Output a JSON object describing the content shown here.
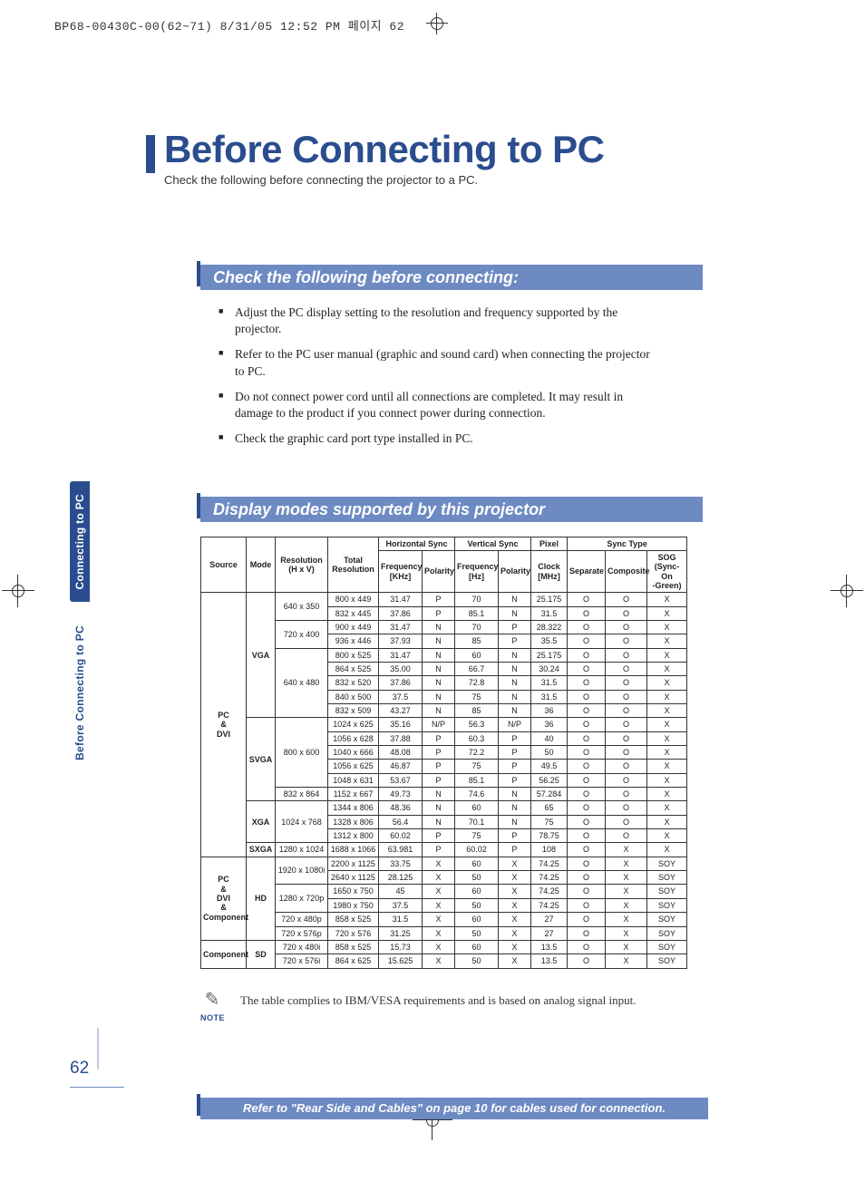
{
  "crop_header": "BP68-00430C-00(62~71)  8/31/05  12:52 PM  페이지 62",
  "side_tabs": {
    "top": "Connecting to PC",
    "bottom": "Before Connecting to PC"
  },
  "title": "Before Connecting to PC",
  "subtitle": "Check the following before connecting the projector to a PC.",
  "section1_heading": "Check the following before connecting:",
  "bullets": [
    "Adjust the PC display setting to the resolution and frequency supported by the projector.",
    "Refer to the PC user manual (graphic and sound card) when connecting the projector to PC.",
    "Do not connect power cord until all connections are completed. It may result in damage to the product if you connect power during connection.",
    "Check the graphic card port type installed in PC."
  ],
  "section2_heading": "Display modes supported by this projector",
  "table_headers": {
    "source": "Source",
    "mode": "Mode",
    "resolution": "Resolution\n(H x V)",
    "total_resolution": "Total\nResolution",
    "h_sync": "Horizontal Sync",
    "h_freq": "Frequency\n[KHz]",
    "h_pol": "Polarity",
    "v_sync": "Vertical Sync",
    "v_freq": "Frequency\n[Hz]",
    "v_pol": "Polarity",
    "pixel": "Pixel",
    "pixel_clock": "Clock\n[MHz]",
    "sync_type": "Sync Type",
    "separate": "Separate",
    "composite": "Composite",
    "sog": "SOG\n(Sync-On\n-Green)"
  },
  "groups": [
    {
      "source": "PC\n&\nDVI",
      "modes": [
        {
          "mode": "VGA",
          "rows": [
            {
              "res": "640 x 350",
              "tot": "800 x 449",
              "hf": "31.47",
              "hp": "P",
              "vf": "70",
              "vp": "N",
              "clk": "25.175",
              "sep": "O",
              "comp": "O",
              "sog": "X"
            },
            {
              "res": "",
              "tot": "832 x 445",
              "hf": "37.86",
              "hp": "P",
              "vf": "85.1",
              "vp": "N",
              "clk": "31.5",
              "sep": "O",
              "comp": "O",
              "sog": "X"
            },
            {
              "res": "720 x 400",
              "tot": "900 x 449",
              "hf": "31.47",
              "hp": "N",
              "vf": "70",
              "vp": "P",
              "clk": "28.322",
              "sep": "O",
              "comp": "O",
              "sog": "X"
            },
            {
              "res": "",
              "tot": "936 x 446",
              "hf": "37.93",
              "hp": "N",
              "vf": "85",
              "vp": "P",
              "clk": "35.5",
              "sep": "O",
              "comp": "O",
              "sog": "X"
            },
            {
              "res": "640 x 480",
              "tot": "800 x 525",
              "hf": "31.47",
              "hp": "N",
              "vf": "60",
              "vp": "N",
              "clk": "25.175",
              "sep": "O",
              "comp": "O",
              "sog": "X"
            },
            {
              "res": "",
              "tot": "864 x 525",
              "hf": "35.00",
              "hp": "N",
              "vf": "66.7",
              "vp": "N",
              "clk": "30.24",
              "sep": "O",
              "comp": "O",
              "sog": "X"
            },
            {
              "res": "",
              "tot": "832 x 520",
              "hf": "37.86",
              "hp": "N",
              "vf": "72.8",
              "vp": "N",
              "clk": "31.5",
              "sep": "O",
              "comp": "O",
              "sog": "X"
            },
            {
              "res": "",
              "tot": "840 x 500",
              "hf": "37.5",
              "hp": "N",
              "vf": "75",
              "vp": "N",
              "clk": "31.5",
              "sep": "O",
              "comp": "O",
              "sog": "X"
            },
            {
              "res": "",
              "tot": "832 x 509",
              "hf": "43.27",
              "hp": "N",
              "vf": "85",
              "vp": "N",
              "clk": "36",
              "sep": "O",
              "comp": "O",
              "sog": "X"
            }
          ]
        },
        {
          "mode": "SVGA",
          "rows": [
            {
              "res": "800 x 600",
              "tot": "1024 x 625",
              "hf": "35.16",
              "hp": "N/P",
              "vf": "56.3",
              "vp": "N/P",
              "clk": "36",
              "sep": "O",
              "comp": "O",
              "sog": "X"
            },
            {
              "res": "",
              "tot": "1056 x 628",
              "hf": "37.88",
              "hp": "P",
              "vf": "60.3",
              "vp": "P",
              "clk": "40",
              "sep": "O",
              "comp": "O",
              "sog": "X"
            },
            {
              "res": "",
              "tot": "1040 x 666",
              "hf": "48.08",
              "hp": "P",
              "vf": "72.2",
              "vp": "P",
              "clk": "50",
              "sep": "O",
              "comp": "O",
              "sog": "X"
            },
            {
              "res": "",
              "tot": "1056 x 625",
              "hf": "46.87",
              "hp": "P",
              "vf": "75",
              "vp": "P",
              "clk": "49.5",
              "sep": "O",
              "comp": "O",
              "sog": "X"
            },
            {
              "res": "",
              "tot": "1048 x 631",
              "hf": "53.67",
              "hp": "P",
              "vf": "85.1",
              "vp": "P",
              "clk": "56.25",
              "sep": "O",
              "comp": "O",
              "sog": "X"
            },
            {
              "res": "832 x 864",
              "tot": "1152 x 667",
              "hf": "49.73",
              "hp": "N",
              "vf": "74.6",
              "vp": "N",
              "clk": "57.284",
              "sep": "O",
              "comp": "O",
              "sog": "X"
            }
          ]
        },
        {
          "mode": "XGA",
          "rows": [
            {
              "res": "1024 x 768",
              "tot": "1344 x 806",
              "hf": "48.36",
              "hp": "N",
              "vf": "60",
              "vp": "N",
              "clk": "65",
              "sep": "O",
              "comp": "O",
              "sog": "X"
            },
            {
              "res": "",
              "tot": "1328 x 806",
              "hf": "56.4",
              "hp": "N",
              "vf": "70.1",
              "vp": "N",
              "clk": "75",
              "sep": "O",
              "comp": "O",
              "sog": "X"
            },
            {
              "res": "",
              "tot": "1312 x 800",
              "hf": "60.02",
              "hp": "P",
              "vf": "75",
              "vp": "P",
              "clk": "78.75",
              "sep": "O",
              "comp": "O",
              "sog": "X"
            }
          ]
        },
        {
          "mode": "SXGA",
          "rows": [
            {
              "res": "1280 x 1024",
              "tot": "1688 x 1066",
              "hf": "63.981",
              "hp": "P",
              "vf": "60.02",
              "vp": "P",
              "clk": "108",
              "sep": "O",
              "comp": "X",
              "sog": "X"
            }
          ]
        }
      ]
    },
    {
      "source": "PC\n&\nDVI\n&\nComponent",
      "modes": [
        {
          "mode": "HD",
          "rows": [
            {
              "res": "1920 x 1080i",
              "tot": "2200 x 1125",
              "hf": "33.75",
              "hp": "X",
              "vf": "60",
              "vp": "X",
              "clk": "74.25",
              "sep": "O",
              "comp": "X",
              "sog": "SOY"
            },
            {
              "res": "",
              "tot": "2640 x 1125",
              "hf": "28.125",
              "hp": "X",
              "vf": "50",
              "vp": "X",
              "clk": "74.25",
              "sep": "O",
              "comp": "X",
              "sog": "SOY"
            },
            {
              "res": "1280 x 720p",
              "tot": "1650 x 750",
              "hf": "45",
              "hp": "X",
              "vf": "60",
              "vp": "X",
              "clk": "74.25",
              "sep": "O",
              "comp": "X",
              "sog": "SOY"
            },
            {
              "res": "",
              "tot": "1980 x 750",
              "hf": "37.5",
              "hp": "X",
              "vf": "50",
              "vp": "X",
              "clk": "74.25",
              "sep": "O",
              "comp": "X",
              "sog": "SOY"
            },
            {
              "res": "720 x 480p",
              "tot": "858 x 525",
              "hf": "31.5",
              "hp": "X",
              "vf": "60",
              "vp": "X",
              "clk": "27",
              "sep": "O",
              "comp": "X",
              "sog": "SOY"
            },
            {
              "res": "720 x 576p",
              "tot": "720 x 576",
              "hf": "31.25",
              "hp": "X",
              "vf": "50",
              "vp": "X",
              "clk": "27",
              "sep": "O",
              "comp": "X",
              "sog": "SOY"
            }
          ]
        }
      ]
    },
    {
      "source": "Component",
      "modes": [
        {
          "mode": "SD",
          "rows": [
            {
              "res": "720 x 480i",
              "tot": "858 x 525",
              "hf": "15.73",
              "hp": "X",
              "vf": "60",
              "vp": "X",
              "clk": "13.5",
              "sep": "O",
              "comp": "X",
              "sog": "SOY"
            },
            {
              "res": "720 x 576i",
              "tot": "864 x 625",
              "hf": "15.625",
              "hp": "X",
              "vf": "50",
              "vp": "X",
              "clk": "13.5",
              "sep": "O",
              "comp": "X",
              "sog": "SOY"
            }
          ]
        }
      ]
    }
  ],
  "note_label": "NOTE",
  "note_text": "The table complies to IBM/VESA requirements and is based on analog signal input.",
  "bottom_ribbon": "Refer to \"Rear Side and Cables\" on page 10 for cables used for connection.",
  "page_number": "62"
}
